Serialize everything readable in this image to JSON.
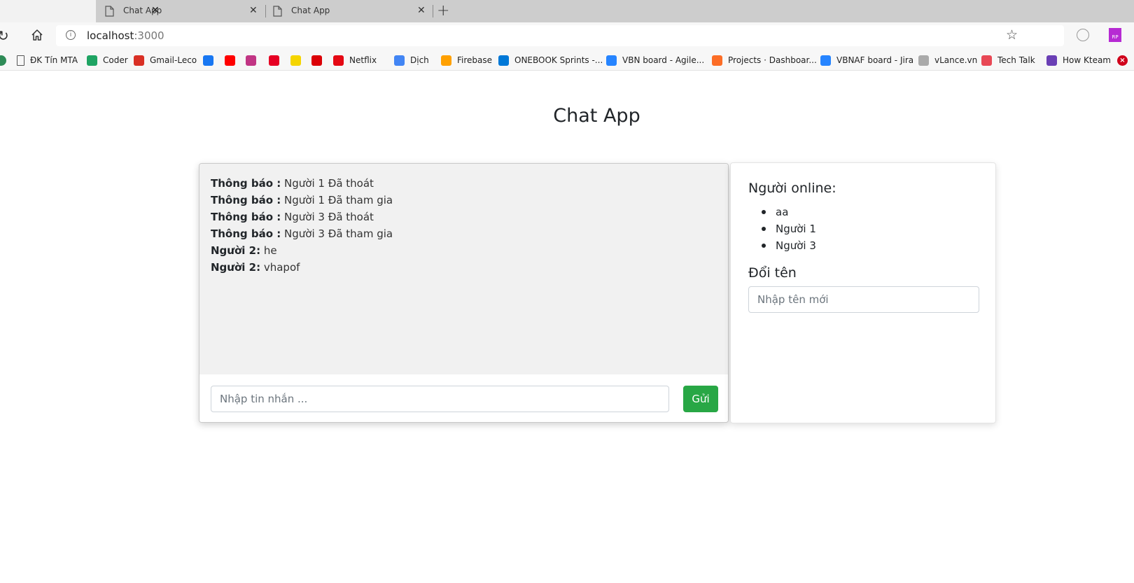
{
  "browser": {
    "tabs": [
      {
        "label": "Chat App"
      },
      {
        "label": "Chat App"
      }
    ],
    "address": {
      "host": "localhost",
      "port": ":3000"
    },
    "bookmarks": [
      {
        "label": "ĐK Tín MTA",
        "icon": "page-icon",
        "color": "#555555"
      },
      {
        "label": "Coder",
        "icon": "google-drive-icon",
        "color": "#1fa463"
      },
      {
        "label": "Gmail-Leco",
        "icon": "gmail-icon",
        "color": "#d93025"
      },
      {
        "label": "",
        "icon": "facebook-icon",
        "color": "#1877f2"
      },
      {
        "label": "",
        "icon": "youtube-icon",
        "color": "#ff0000"
      },
      {
        "label": "",
        "icon": "instagram-icon",
        "color": "#c13584"
      },
      {
        "label": "",
        "icon": "pinterest-icon",
        "color": "#e60023"
      },
      {
        "label": "",
        "icon": "yellow-site-icon",
        "color": "#f5d500"
      },
      {
        "label": "",
        "icon": "arsenal-icon",
        "color": "#db0007"
      },
      {
        "label": "Netflix",
        "icon": "netflix-icon",
        "color": "#e50914"
      },
      {
        "label": "Dịch",
        "icon": "google-translate-icon",
        "color": "#4285f4"
      },
      {
        "label": "Firebase",
        "icon": "firebase-icon",
        "color": "#ffa000"
      },
      {
        "label": "ONEBOOK Sprints -...",
        "icon": "azure-devops-icon",
        "color": "#0078d7"
      },
      {
        "label": "VBN board - Agile...",
        "icon": "jira-icon",
        "color": "#2684ff"
      },
      {
        "label": "Projects · Dashboar...",
        "icon": "gitlab-icon",
        "color": "#fc6d26"
      },
      {
        "label": "VBNAF board - Jira",
        "icon": "jira-icon",
        "color": "#2684ff"
      },
      {
        "label": "vLance.vn",
        "icon": "vlance-icon",
        "color": "#aaaaaa"
      },
      {
        "label": "Tech Talk",
        "icon": "techtalk-icon",
        "color": "#e84855"
      },
      {
        "label": "How Kteam",
        "icon": "kteam-icon",
        "color": "#6a3fb5"
      }
    ]
  },
  "page": {
    "title": "Chat App"
  },
  "chat": {
    "messages": [
      {
        "sender": "Thông báo :",
        "text": " Người 1 Đã thoát"
      },
      {
        "sender": "Thông báo :",
        "text": " Người 1 Đã tham gia"
      },
      {
        "sender": "Thông báo :",
        "text": " Người 3 Đã thoát"
      },
      {
        "sender": "Thông báo :",
        "text": " Người 3 Đã tham gia"
      },
      {
        "sender": "Người 2:",
        "text": " he"
      },
      {
        "sender": "Người 2:",
        "text": " vhapof"
      }
    ],
    "input_placeholder": "Nhập tin nhắn ...",
    "send_label": "Gửi",
    "send_color": "#28a745"
  },
  "sidebar": {
    "online_title": "Người online:",
    "online_users": [
      "aa",
      "Người 1",
      "Người 3"
    ],
    "rename_title": "Đổi tên",
    "rename_placeholder": "Nhập tên mới"
  }
}
